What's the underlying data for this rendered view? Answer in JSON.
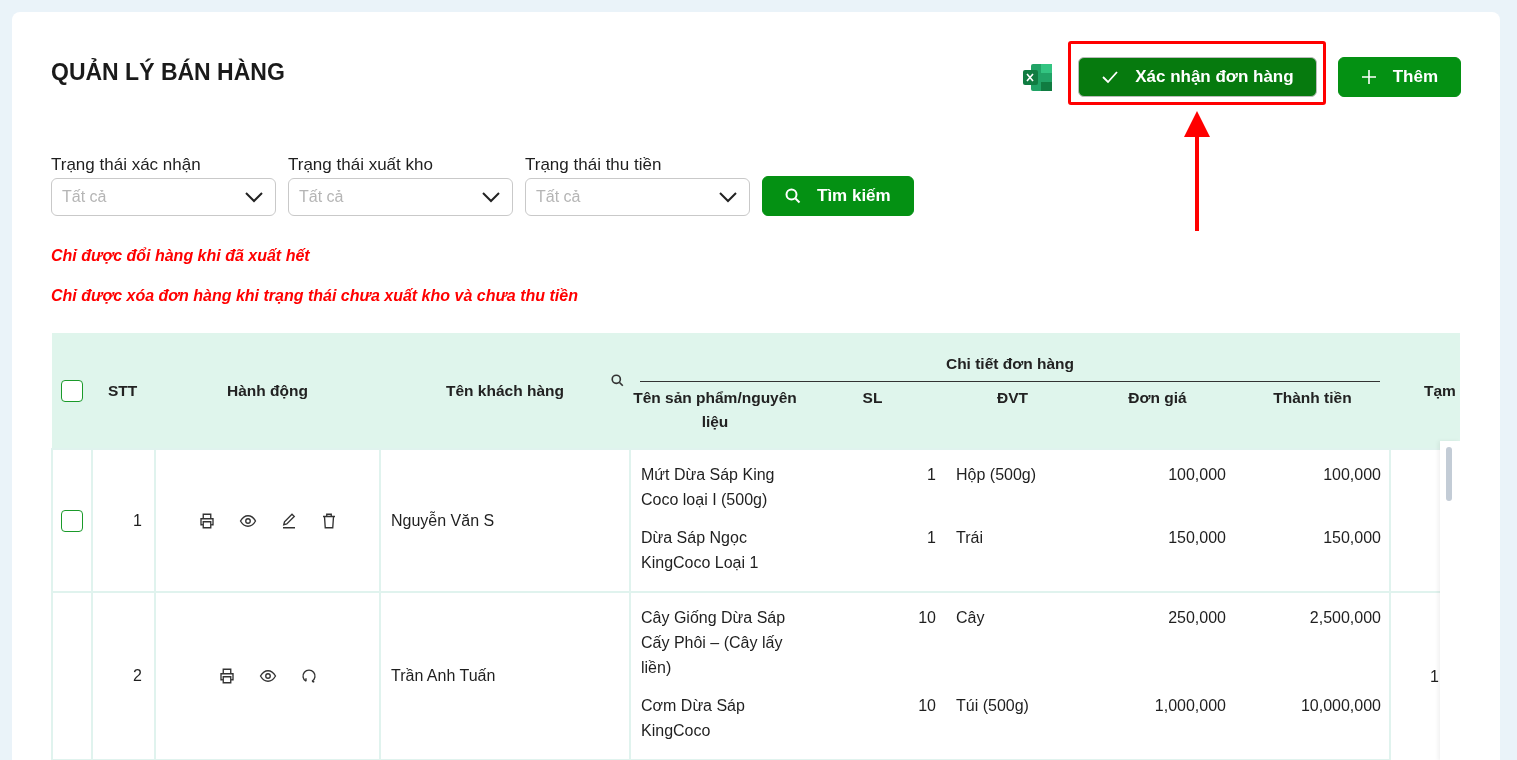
{
  "page": {
    "title": "QUẢN LÝ BÁN HÀNG"
  },
  "toolbar": {
    "buttons": [
      {
        "kind": "confirm",
        "label": "Xác nhận đơn hàng",
        "highlighted": true
      },
      {
        "kind": "add",
        "label": "Thêm",
        "highlighted": false
      }
    ]
  },
  "filters": [
    {
      "label": "Trạng thái xác nhận",
      "placeholder": "Tất cả"
    },
    {
      "label": "Trạng thái xuất kho",
      "placeholder": "Tất cả"
    },
    {
      "label": "Trạng thái thu tiền",
      "placeholder": "Tất cả"
    }
  ],
  "search_button": {
    "label": "Tìm kiếm"
  },
  "notes": [
    "Chỉ được đổi hàng khi đã xuất hết",
    "Chỉ được xóa đơn hàng khi trạng thái chưa xuất kho và chưa thu tiền"
  ],
  "table": {
    "select_all_checked": false,
    "columns": [
      {
        "label": "STT",
        "searchable": false
      },
      {
        "label": "Hành động",
        "searchable": false
      },
      {
        "label": "Tên khách hàng",
        "searchable": true
      }
    ],
    "group": {
      "label": "Chi tiết đơn hàng",
      "columns": [
        "Tên sản phẩm/nguyên liệu",
        "SL",
        "ĐVT",
        "Đơn giá",
        "Thành tiền"
      ]
    },
    "column_10": "Tạm",
    "rows": [
      {
        "checkbox": {
          "checked": false
        },
        "stt": "1",
        "actions": [
          {
            "kind": "print"
          },
          {
            "kind": "view"
          },
          {
            "kind": "edit"
          },
          {
            "kind": "delete"
          }
        ],
        "customer": "Nguyễn Văn S",
        "items": [
          {
            "product": "Mứt Dừa Sáp King Coco loại I (500g)",
            "qty": "1",
            "unit": "Hộp (500g)",
            "unit_price": "100,000",
            "amount": "100,000"
          },
          {
            "product": "Dừa Sáp Ngọc KingCoco Loại 1",
            "qty": "1",
            "unit": "Trái",
            "unit_price": "150,000",
            "amount": "150,000"
          }
        ]
      },
      {
        "stt": "2",
        "actions": [
          {
            "kind": "print"
          },
          {
            "kind": "view"
          },
          {
            "kind": "refresh"
          }
        ],
        "customer": "Trần Anh Tuấn",
        "items": [
          {
            "product": "Cây Giống Dừa Sáp Cấy Phôi – (Cây lấy liền)",
            "qty": "10",
            "unit": "Cây",
            "unit_price": "250,000",
            "amount": "2,500,000"
          },
          {
            "product": "Cơm Dừa Sáp KingCoco",
            "qty": "10",
            "unit": "Túi (500g)",
            "unit_price": "1,000,000",
            "amount": "10,000,000"
          }
        ],
        "column_10": "1"
      }
    ]
  }
}
